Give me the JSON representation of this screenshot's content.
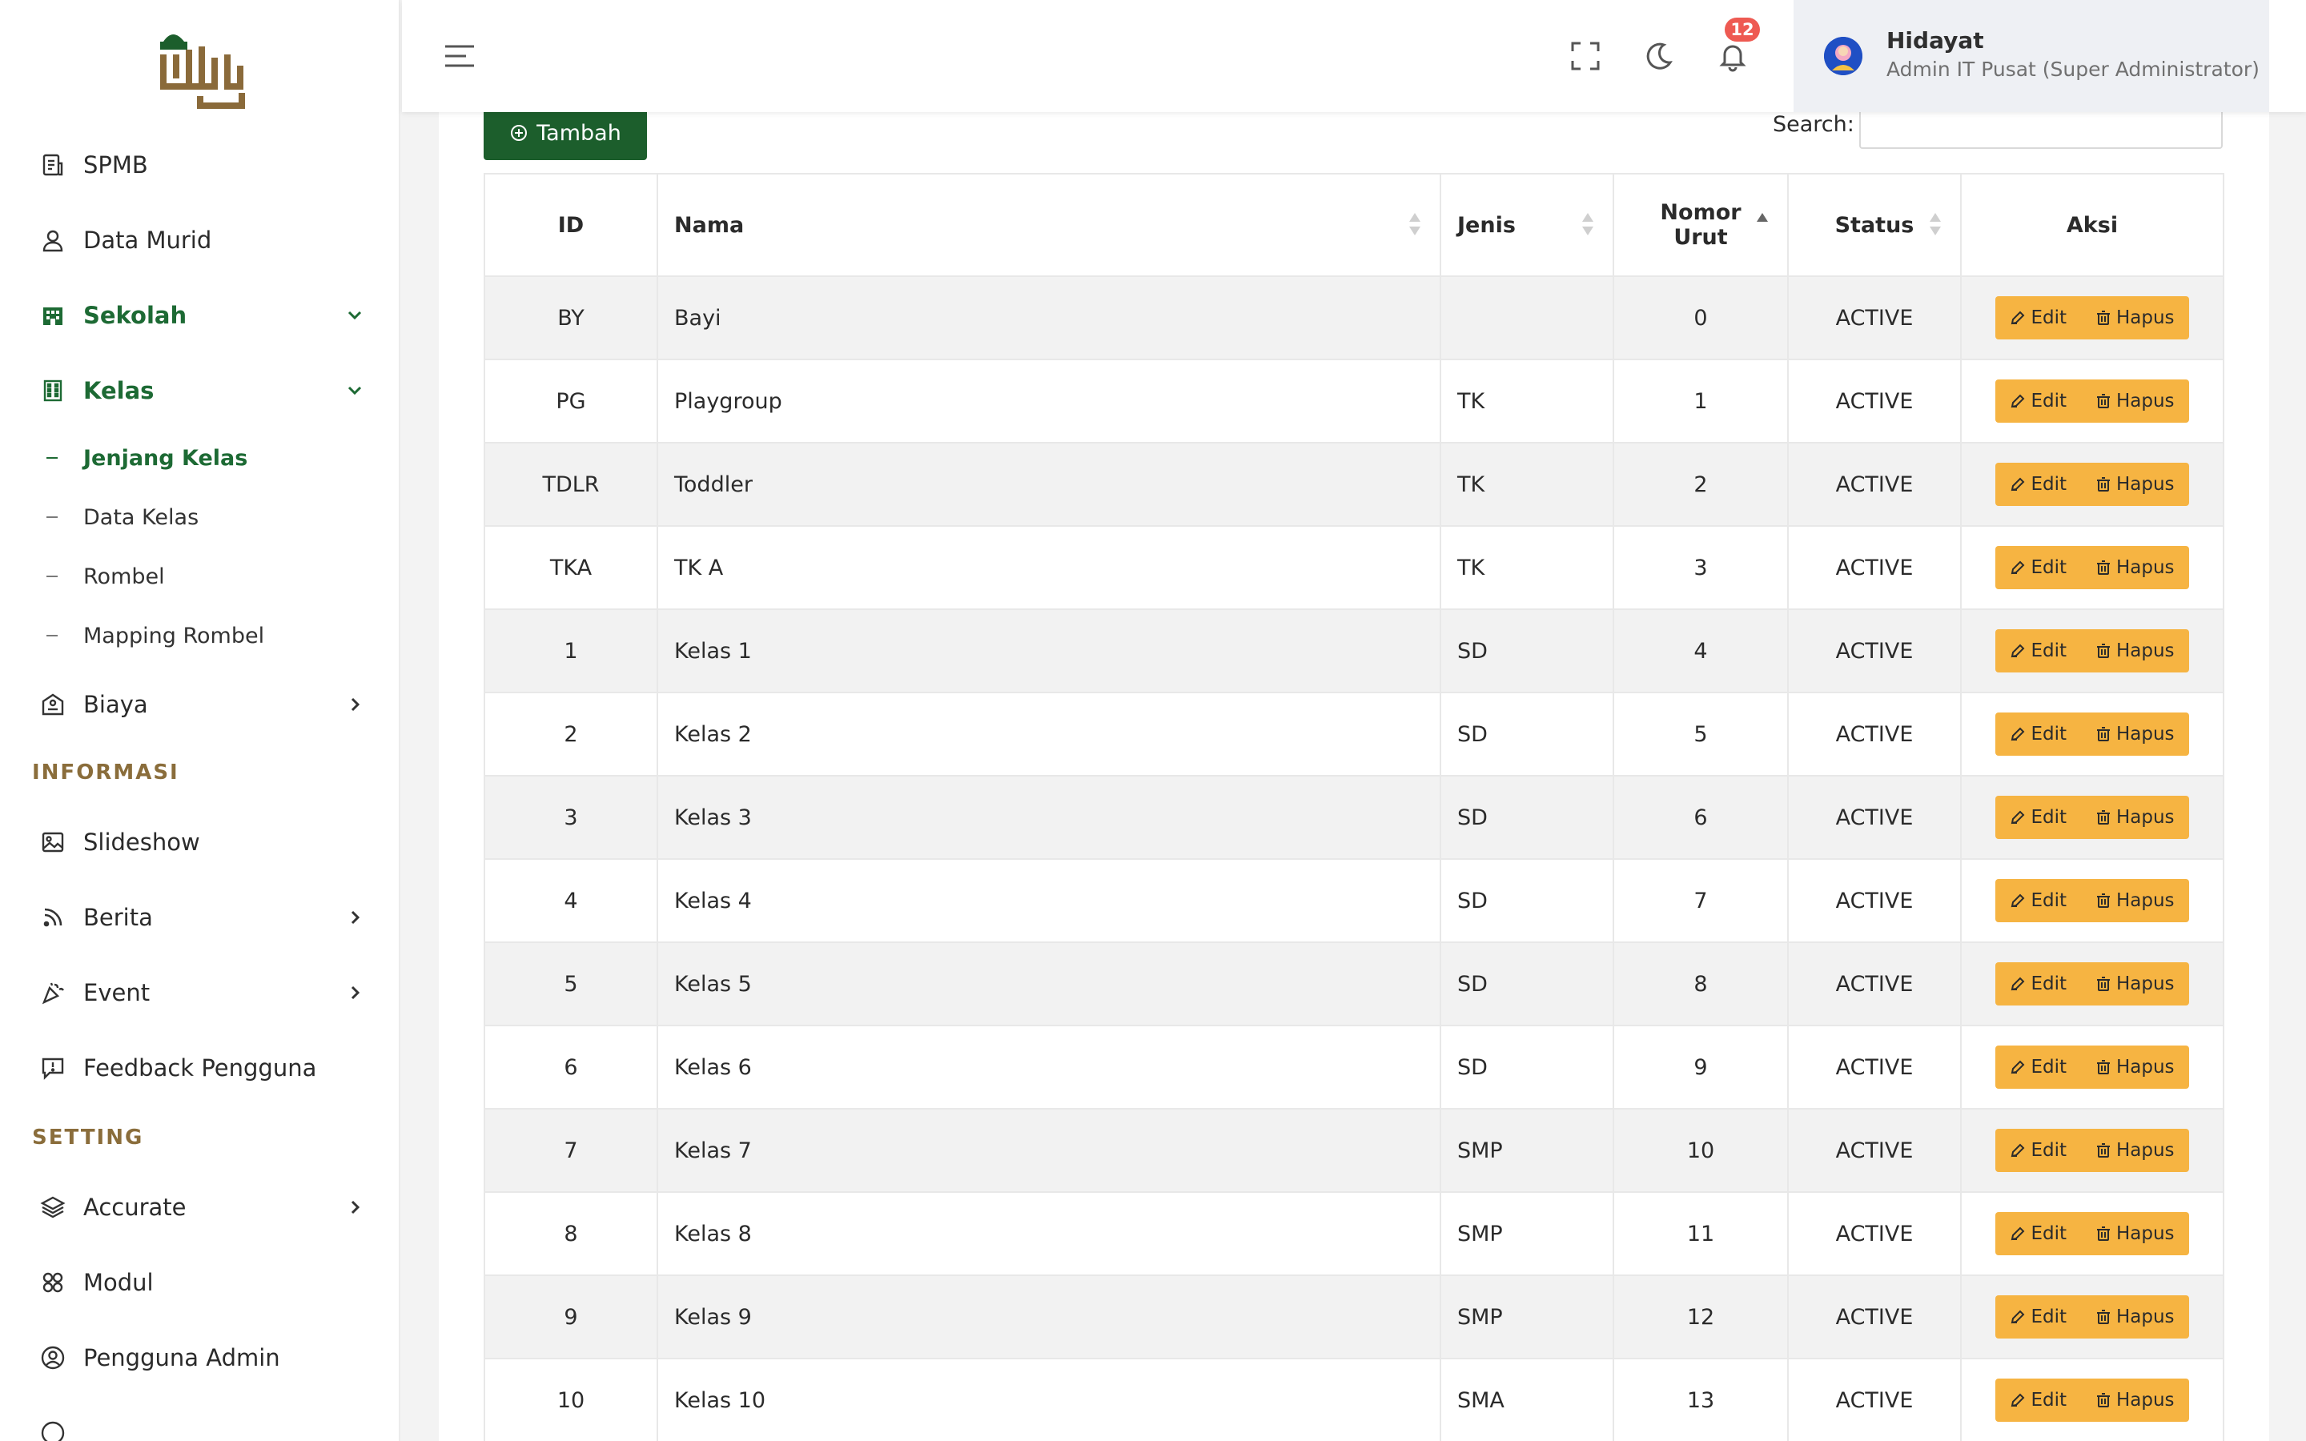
{
  "colors": {
    "brand_green": "#1c5e2c",
    "active_nav": "#1d6a34",
    "section_header": "#8a6d3b",
    "action_orange": "#f6b442",
    "badge_red": "#ee5a52"
  },
  "sidebar": {
    "items": [
      {
        "label": "SPMB",
        "icon": "document-icon"
      },
      {
        "label": "Data Murid",
        "icon": "user-icon"
      },
      {
        "label": "Sekolah",
        "icon": "building-icon"
      },
      {
        "label": "Kelas",
        "icon": "building-grid-icon"
      }
    ],
    "kelas_sub": [
      "Jenjang Kelas",
      "Data Kelas",
      "Rombel",
      "Mapping Rombel"
    ],
    "biaya": "Biaya",
    "sections": {
      "informasi": "INFORMASI",
      "setting": "SETTING"
    },
    "informasi_items": [
      {
        "label": "Slideshow",
        "icon": "image-icon"
      },
      {
        "label": "Berita",
        "icon": "rss-icon"
      },
      {
        "label": "Event",
        "icon": "confetti-icon"
      },
      {
        "label": "Feedback Pengguna",
        "icon": "feedback-icon"
      }
    ],
    "setting_items": [
      {
        "label": "Accurate",
        "icon": "layers-icon"
      },
      {
        "label": "Modul",
        "icon": "modules-icon"
      },
      {
        "label": "Pengguna Admin",
        "icon": "user-circle-icon"
      }
    ]
  },
  "topbar": {
    "notification_count": "12",
    "user_name": "Hidayat",
    "user_role": "Admin IT Pusat (Super Administrator)"
  },
  "toolbar": {
    "add_label": "Tambah",
    "search_label": "Search:",
    "search_value": ""
  },
  "table": {
    "headers": {
      "id": "ID",
      "nama": "Nama",
      "jenis": "Jenis",
      "nomor_urut_1": "Nomor",
      "nomor_urut_2": "Urut",
      "status": "Status",
      "aksi": "Aksi"
    },
    "edit_label": "Edit",
    "delete_label": "Hapus",
    "rows": [
      {
        "id": "BY",
        "nama": "Bayi",
        "jenis": "",
        "urut": "0",
        "status": "ACTIVE"
      },
      {
        "id": "PG",
        "nama": "Playgroup",
        "jenis": "TK",
        "urut": "1",
        "status": "ACTIVE"
      },
      {
        "id": "TDLR",
        "nama": "Toddler",
        "jenis": "TK",
        "urut": "2",
        "status": "ACTIVE"
      },
      {
        "id": "TKA",
        "nama": "TK A",
        "jenis": "TK",
        "urut": "3",
        "status": "ACTIVE"
      },
      {
        "id": "1",
        "nama": "Kelas 1",
        "jenis": "SD",
        "urut": "4",
        "status": "ACTIVE"
      },
      {
        "id": "2",
        "nama": "Kelas 2",
        "jenis": "SD",
        "urut": "5",
        "status": "ACTIVE"
      },
      {
        "id": "3",
        "nama": "Kelas 3",
        "jenis": "SD",
        "urut": "6",
        "status": "ACTIVE"
      },
      {
        "id": "4",
        "nama": "Kelas 4",
        "jenis": "SD",
        "urut": "7",
        "status": "ACTIVE"
      },
      {
        "id": "5",
        "nama": "Kelas 5",
        "jenis": "SD",
        "urut": "8",
        "status": "ACTIVE"
      },
      {
        "id": "6",
        "nama": "Kelas 6",
        "jenis": "SD",
        "urut": "9",
        "status": "ACTIVE"
      },
      {
        "id": "7",
        "nama": "Kelas 7",
        "jenis": "SMP",
        "urut": "10",
        "status": "ACTIVE"
      },
      {
        "id": "8",
        "nama": "Kelas 8",
        "jenis": "SMP",
        "urut": "11",
        "status": "ACTIVE"
      },
      {
        "id": "9",
        "nama": "Kelas 9",
        "jenis": "SMP",
        "urut": "12",
        "status": "ACTIVE"
      },
      {
        "id": "10",
        "nama": "Kelas 10",
        "jenis": "SMA",
        "urut": "13",
        "status": "ACTIVE"
      }
    ]
  }
}
